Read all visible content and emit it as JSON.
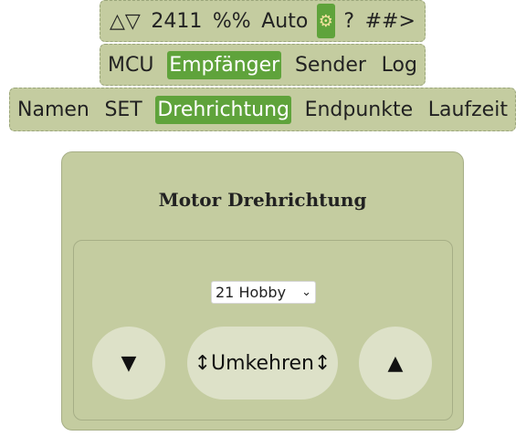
{
  "topbar": {
    "toggle_label": "△▽",
    "number": "2411",
    "percent_label": "%%",
    "auto_label": "Auto",
    "gear_icon": "⚙",
    "help_label": "?",
    "next_label": "##>"
  },
  "section_tabs": [
    {
      "label": "MCU",
      "active": false
    },
    {
      "label": "Empfänger",
      "active": true
    },
    {
      "label": "Sender",
      "active": false
    },
    {
      "label": "Log",
      "active": false
    }
  ],
  "sub_tabs": [
    {
      "label": "Namen",
      "active": false
    },
    {
      "label": "SET",
      "active": false
    },
    {
      "label": "Drehrichtung",
      "active": true
    },
    {
      "label": "Endpunkte",
      "active": false
    },
    {
      "label": "Laufzeit",
      "active": false
    }
  ],
  "panel": {
    "title": "Motor Drehrichtung",
    "select_value": "21 Hobby",
    "down_label": "▼",
    "reverse_label": "↕Umkehren↕",
    "up_label": "▲"
  },
  "colors": {
    "panel_bg": "#c4cca0",
    "active_bg": "#5fa33b",
    "button_bg": "#dde1c8"
  }
}
